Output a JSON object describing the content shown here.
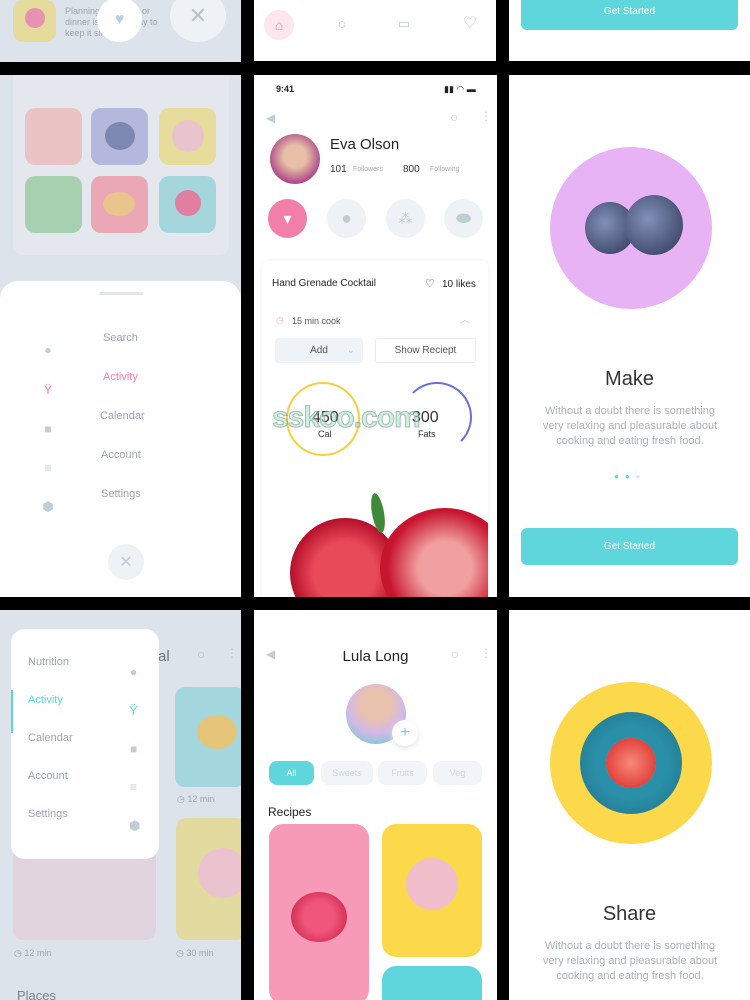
{
  "top_left": {
    "text": "Planning breakfast or dinner is a good way to keep it simple",
    "icons": [
      "heart-icon",
      "close-icon"
    ]
  },
  "top_mid": {
    "nav": [
      "home-icon",
      "search-icon",
      "calendar-icon",
      "heart-icon"
    ]
  },
  "top_right": {
    "button": "Get Started"
  },
  "menu_screen": {
    "items": [
      {
        "label": "Search",
        "icon": "search-icon"
      },
      {
        "label": "Activity",
        "icon": "activity-icon"
      },
      {
        "label": "Calendar",
        "icon": "calendar-icon"
      },
      {
        "label": "Account",
        "icon": "filter-icon"
      },
      {
        "label": "Settings",
        "icon": "hexagon-icon"
      }
    ],
    "active": "Activity",
    "close_icon": "close-icon"
  },
  "profile": {
    "status_time": "9:41",
    "name": "Eva Olson",
    "followers_count": "101",
    "followers_label": "Followers",
    "following_count": "800",
    "following_label": "Following",
    "categories": [
      "cocktail-icon",
      "circle-icon",
      "wheat-icon",
      "pill-icon"
    ],
    "recipe": {
      "title": "Hand Grenade Cocktail",
      "likes": "10 likes",
      "cook_time": "15 min cook",
      "add_label": "Add",
      "show_label": "Show Reciept",
      "cal_value": "450",
      "cal_label": "Cal",
      "fats_value": "300",
      "fats_label": "Fats"
    }
  },
  "onboard_make": {
    "title": "Make",
    "text": "Without a doubt there is something very relaxing and pleasurable about cooking and eating fresh food.",
    "button": "Get Started",
    "page": 1,
    "pages": 3
  },
  "side_menu": {
    "items": [
      "Nutrition",
      "Activity",
      "Calendar",
      "Account",
      "Settings"
    ],
    "active": "Activity",
    "header_partial": "al",
    "cards": [
      {
        "time": "12 min"
      },
      {
        "time": "12 min"
      },
      {
        "time": "30 min"
      }
    ],
    "section": "Places"
  },
  "lula": {
    "name": "Lula Long",
    "filters": [
      "All",
      "Sweets",
      "Fruits",
      "Veg"
    ],
    "active_filter": "All",
    "section": "Recipes"
  },
  "onboard_share": {
    "title": "Share",
    "text": "Without a doubt there is something very relaxing and pleasurable about cooking and eating fresh food."
  },
  "watermark": "sskoo.com",
  "colors": {
    "teal": "#5ed6dc",
    "pink": "#f17fa8",
    "yellow": "#fcd94a",
    "lilac": "#e7b3f5"
  }
}
